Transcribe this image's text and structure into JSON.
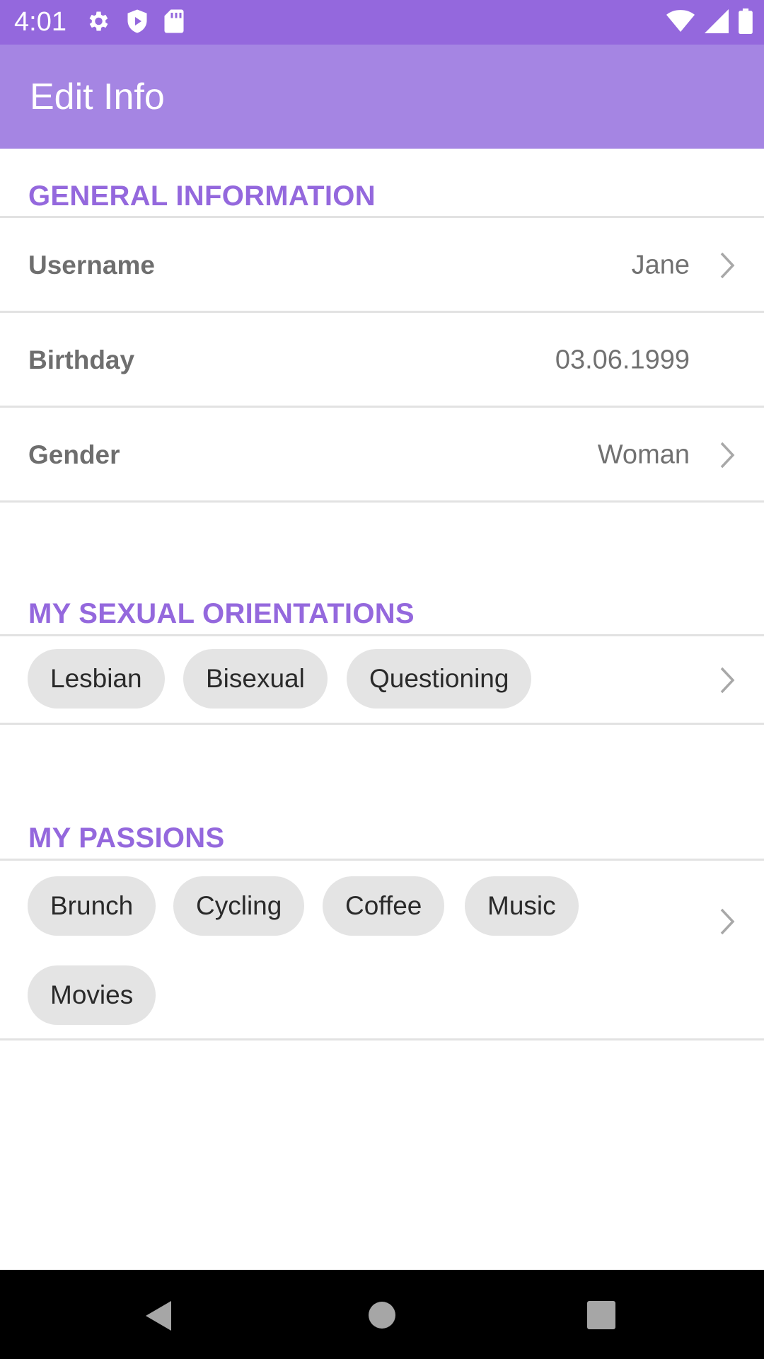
{
  "status_bar": {
    "time": "4:01",
    "icons_left": [
      "settings-icon",
      "shield-play-icon",
      "sd-card-icon"
    ],
    "icons_right": [
      "wifi-icon",
      "signal-icon",
      "battery-icon"
    ],
    "background_color": "#9468dd"
  },
  "app_bar": {
    "title": "Edit Info",
    "background_color": "#a585e3"
  },
  "general": {
    "header": "GENERAL INFORMATION",
    "rows": [
      {
        "label": "Username",
        "value": "Jane",
        "has_chevron": true
      },
      {
        "label": "Birthday",
        "value": "03.06.1999",
        "has_chevron": false
      },
      {
        "label": "Gender",
        "value": "Woman",
        "has_chevron": true
      }
    ]
  },
  "orientations": {
    "header": "MY SEXUAL ORIENTATIONS",
    "chips": [
      "Lesbian",
      "Bisexual",
      "Questioning"
    ]
  },
  "passions": {
    "header": "MY PASSIONS",
    "chips": [
      "Brunch",
      "Cycling",
      "Coffee",
      "Music",
      "Movies"
    ]
  },
  "nav_bar": {
    "buttons": [
      "back-icon",
      "home-icon",
      "recents-icon"
    ]
  },
  "colors": {
    "accent": "#9468dd",
    "chip_background": "#e4e4e4",
    "label_text": "#6e6e6e",
    "divider": "#e2e2e2"
  }
}
